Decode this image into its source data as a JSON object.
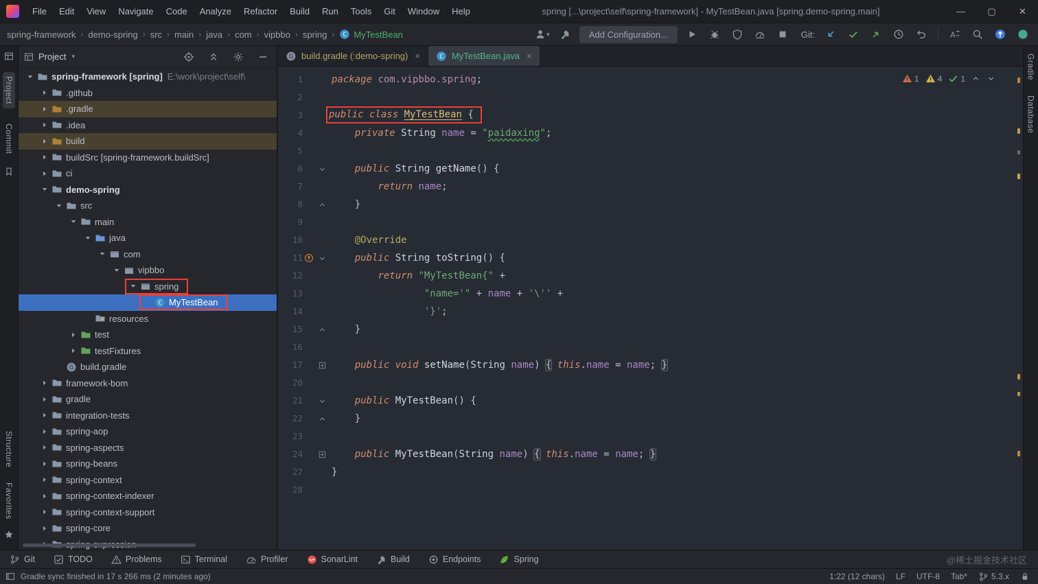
{
  "window": {
    "title": "spring [...\\project\\self\\spring-framework] - MyTestBean.java [spring.demo-spring.main]",
    "menus": [
      "File",
      "Edit",
      "View",
      "Navigate",
      "Code",
      "Analyze",
      "Refactor",
      "Build",
      "Run",
      "Tools",
      "Git",
      "Window",
      "Help"
    ],
    "controls": {
      "minimize": "—",
      "maximize": "▢",
      "close": "✕"
    }
  },
  "navbar": {
    "breadcrumbs": [
      "spring-framework",
      "demo-spring",
      "src",
      "main",
      "java",
      "com",
      "vipbbo",
      "spring"
    ],
    "breadcrumb_class": "MyTestBean",
    "actions": [
      {
        "icon": "user",
        "dropdown": true
      },
      {
        "icon": "hammer-green"
      },
      {
        "type": "button",
        "label": "Add Configuration..."
      },
      {
        "icon": "run"
      },
      {
        "icon": "debug"
      },
      {
        "icon": "coverage"
      },
      {
        "icon": "profiler-run"
      },
      {
        "icon": "stop"
      },
      {
        "type": "label",
        "label": "Git:"
      },
      {
        "icon": "update-project"
      },
      {
        "icon": "commit-check"
      },
      {
        "icon": "push"
      },
      {
        "icon": "history"
      },
      {
        "icon": "rollback"
      },
      {
        "type": "sep"
      },
      {
        "icon": "translate"
      },
      {
        "icon": "search"
      },
      {
        "icon": "updates"
      },
      {
        "icon": "status-dot"
      }
    ]
  },
  "left_stripe": {
    "top": [
      "Project",
      "Commit"
    ],
    "bottom": [
      "Structure",
      "Favorites"
    ]
  },
  "right_stripe": [
    "Gradle",
    "Database"
  ],
  "project": {
    "header": "Project",
    "header_actions": [
      "target",
      "collapse-all",
      "gear",
      "hide-minus"
    ],
    "tree": [
      {
        "d": 0,
        "chev": "open",
        "icon": "folder",
        "label": "spring-framework [spring]",
        "path": "E:\\work\\project\\self\\",
        "bold": true
      },
      {
        "d": 1,
        "chev": "closed",
        "icon": "folder",
        "label": ".github"
      },
      {
        "d": 1,
        "chev": "closed",
        "icon": "folder-excluded",
        "label": ".gradle",
        "hl": true
      },
      {
        "d": 1,
        "chev": "closed",
        "icon": "folder",
        "label": ".idea"
      },
      {
        "d": 1,
        "chev": "closed",
        "icon": "folder-excluded",
        "label": "build",
        "hl": true
      },
      {
        "d": 1,
        "chev": "closed",
        "icon": "folder",
        "label": "buildSrc [spring-framework.buildSrc]"
      },
      {
        "d": 1,
        "chev": "closed",
        "icon": "folder",
        "label": "ci"
      },
      {
        "d": 1,
        "chev": "open",
        "icon": "folder",
        "label": "demo-spring",
        "bold": true
      },
      {
        "d": 2,
        "chev": "open",
        "icon": "folder",
        "label": "src"
      },
      {
        "d": 3,
        "chev": "open",
        "icon": "folder",
        "label": "main"
      },
      {
        "d": 4,
        "chev": "open",
        "icon": "folder-source",
        "label": "java"
      },
      {
        "d": 5,
        "chev": "open",
        "icon": "package",
        "label": "com"
      },
      {
        "d": 6,
        "chev": "open",
        "icon": "package",
        "label": "vipbbo"
      },
      {
        "d": 7,
        "chev": "open",
        "icon": "package",
        "label": "spring",
        "redbox": true
      },
      {
        "d": 8,
        "chev": "none",
        "icon": "class",
        "label": "MyTestBean",
        "selected": true,
        "redbox": true
      },
      {
        "d": 4,
        "chev": "none",
        "icon": "folder-resources",
        "label": "resources"
      },
      {
        "d": 3,
        "chev": "closed",
        "icon": "folder-test",
        "label": "test"
      },
      {
        "d": 3,
        "chev": "closed",
        "icon": "folder-test",
        "label": "testFixtures"
      },
      {
        "d": 2,
        "chev": "none",
        "icon": "gradle",
        "label": "build.gradle"
      },
      {
        "d": 1,
        "chev": "closed",
        "icon": "folder",
        "label": "framework-bom"
      },
      {
        "d": 1,
        "chev": "closed",
        "icon": "folder",
        "label": "gradle"
      },
      {
        "d": 1,
        "chev": "closed",
        "icon": "folder",
        "label": "integration-tests"
      },
      {
        "d": 1,
        "chev": "closed",
        "icon": "folder",
        "label": "spring-aop"
      },
      {
        "d": 1,
        "chev": "closed",
        "icon": "folder",
        "label": "spring-aspects"
      },
      {
        "d": 1,
        "chev": "closed",
        "icon": "folder",
        "label": "spring-beans"
      },
      {
        "d": 1,
        "chev": "closed",
        "icon": "folder",
        "label": "spring-context"
      },
      {
        "d": 1,
        "chev": "closed",
        "icon": "folder",
        "label": "spring-context-indexer"
      },
      {
        "d": 1,
        "chev": "closed",
        "icon": "folder",
        "label": "spring-context-support"
      },
      {
        "d": 1,
        "chev": "closed",
        "icon": "folder",
        "label": "spring-core"
      },
      {
        "d": 1,
        "chev": "closed",
        "icon": "folder",
        "label": "spring-expression"
      }
    ]
  },
  "editor": {
    "tabs": [
      {
        "label": "build.gradle (:demo-spring)",
        "icon": "gradle",
        "active": false,
        "color": "#b6a763"
      },
      {
        "label": "MyTestBean.java",
        "icon": "class",
        "active": true,
        "color": "#52b787"
      }
    ],
    "inspections": {
      "items": [
        {
          "icon": "warn-red",
          "count": "1",
          "name": "weak-warnings-badge"
        },
        {
          "icon": "warn-yellow",
          "count": "4",
          "name": "warnings-badge"
        },
        {
          "icon": "ok-check",
          "count": "1",
          "name": "no-errors-badge"
        }
      ]
    },
    "code": [
      {
        "n": "1",
        "t": [
          [
            "kw",
            "package"
          ],
          [
            "pl",
            " "
          ],
          [
            "pkg",
            "com.vipbbo.spring"
          ],
          [
            "pl",
            ";"
          ]
        ]
      },
      {
        "n": "2",
        "t": []
      },
      {
        "n": "3",
        "box": true,
        "t": [
          [
            "kw",
            "public class"
          ],
          [
            "pl",
            " "
          ],
          [
            "cls",
            "MyTestBean"
          ],
          [
            "pl",
            " {"
          ]
        ]
      },
      {
        "n": "4",
        "t": [
          [
            "pl",
            "    "
          ],
          [
            "kw",
            "private"
          ],
          [
            "pl",
            " "
          ],
          [
            "typ",
            "String"
          ],
          [
            "pl",
            " "
          ],
          [
            "fld",
            "name"
          ],
          [
            "pl",
            " = "
          ],
          [
            "str",
            "\""
          ],
          [
            "typo",
            "paidaxing"
          ],
          [
            "str",
            "\""
          ],
          [
            "pl",
            ";"
          ]
        ]
      },
      {
        "n": "5",
        "t": []
      },
      {
        "n": "6",
        "f": "open",
        "t": [
          [
            "pl",
            "    "
          ],
          [
            "kw",
            "public"
          ],
          [
            "pl",
            " "
          ],
          [
            "typ",
            "String"
          ],
          [
            "pl",
            " "
          ],
          [
            "mtd",
            "getName"
          ],
          [
            "pl",
            "() {"
          ]
        ]
      },
      {
        "n": "7",
        "t": [
          [
            "pl",
            "        "
          ],
          [
            "kw",
            "return"
          ],
          [
            "pl",
            " "
          ],
          [
            "fld",
            "name"
          ],
          [
            "pl",
            ";"
          ]
        ]
      },
      {
        "n": "8",
        "f": "close",
        "t": [
          [
            "pl",
            "    }"
          ]
        ]
      },
      {
        "n": "9",
        "t": []
      },
      {
        "n": "10",
        "t": [
          [
            "pl",
            "    "
          ],
          [
            "ann",
            "@Override"
          ]
        ]
      },
      {
        "n": "11",
        "ic": "override",
        "f": "open",
        "t": [
          [
            "pl",
            "    "
          ],
          [
            "kw",
            "public"
          ],
          [
            "pl",
            " "
          ],
          [
            "typ",
            "String"
          ],
          [
            "pl",
            " "
          ],
          [
            "mtd",
            "toString"
          ],
          [
            "pl",
            "() {"
          ]
        ]
      },
      {
        "n": "12",
        "t": [
          [
            "pl",
            "        "
          ],
          [
            "kw",
            "return"
          ],
          [
            "pl",
            " "
          ],
          [
            "str",
            "\"MyTestBean{\""
          ],
          [
            "pl",
            " +"
          ]
        ]
      },
      {
        "n": "13",
        "t": [
          [
            "pl",
            "                "
          ],
          [
            "str",
            "\"name='\""
          ],
          [
            "pl",
            " + "
          ],
          [
            "fld",
            "name"
          ],
          [
            "pl",
            " + "
          ],
          [
            "str",
            "'\\''"
          ],
          [
            "pl",
            " +"
          ]
        ]
      },
      {
        "n": "14",
        "t": [
          [
            "pl",
            "                "
          ],
          [
            "str",
            "'}'"
          ],
          [
            "pl",
            ";"
          ]
        ]
      },
      {
        "n": "15",
        "f": "close",
        "t": [
          [
            "pl",
            "    }"
          ]
        ]
      },
      {
        "n": "16",
        "t": []
      },
      {
        "n": "17",
        "f": "plus",
        "t": [
          [
            "pl",
            "    "
          ],
          [
            "kw",
            "public void"
          ],
          [
            "pl",
            " "
          ],
          [
            "mtd",
            "setName"
          ],
          [
            "pl",
            "("
          ],
          [
            "typ",
            "String"
          ],
          [
            "pl",
            " "
          ],
          [
            "fld",
            "name"
          ],
          [
            "pl",
            ") "
          ],
          [
            "fb",
            "{"
          ],
          [
            "pl",
            " "
          ],
          [
            "kw",
            "this"
          ],
          [
            "pl",
            "."
          ],
          [
            "fld",
            "name"
          ],
          [
            "pl",
            " = "
          ],
          [
            "fld",
            "name"
          ],
          [
            "pl",
            "; "
          ],
          [
            "fb",
            "}"
          ]
        ]
      },
      {
        "n": "20",
        "t": []
      },
      {
        "n": "21",
        "f": "open",
        "t": [
          [
            "pl",
            "    "
          ],
          [
            "kw",
            "public"
          ],
          [
            "pl",
            " "
          ],
          [
            "mtd",
            "MyTestBean"
          ],
          [
            "pl",
            "() {"
          ]
        ]
      },
      {
        "n": "22",
        "f": "close",
        "t": [
          [
            "pl",
            "    }"
          ]
        ]
      },
      {
        "n": "23",
        "t": []
      },
      {
        "n": "24",
        "f": "plus",
        "t": [
          [
            "pl",
            "    "
          ],
          [
            "kw",
            "public"
          ],
          [
            "pl",
            " "
          ],
          [
            "mtd",
            "MyTestBean"
          ],
          [
            "pl",
            "("
          ],
          [
            "typ",
            "String"
          ],
          [
            "pl",
            " "
          ],
          [
            "fld",
            "name"
          ],
          [
            "pl",
            ") "
          ],
          [
            "fb",
            "{"
          ],
          [
            "pl",
            " "
          ],
          [
            "kw",
            "this"
          ],
          [
            "pl",
            "."
          ],
          [
            "fld",
            "name"
          ],
          [
            "pl",
            " = "
          ],
          [
            "fld",
            "name"
          ],
          [
            "pl",
            "; "
          ],
          [
            "fb",
            "}"
          ]
        ]
      },
      {
        "n": "27",
        "t": [
          [
            "pl",
            "}"
          ]
        ]
      },
      {
        "n": "28",
        "t": []
      }
    ]
  },
  "bottom_bar": [
    {
      "label": "Git",
      "icon": "git-branch"
    },
    {
      "label": "TODO",
      "icon": "todo"
    },
    {
      "label": "Problems",
      "icon": "problems"
    },
    {
      "label": "Terminal",
      "icon": "terminal"
    },
    {
      "label": "Profiler",
      "icon": "profiler"
    },
    {
      "label": "SonarLint",
      "icon": "sonarlint"
    },
    {
      "label": "Build",
      "icon": "build-hammer"
    },
    {
      "label": "Endpoints",
      "icon": "endpoints"
    },
    {
      "label": "Spring",
      "icon": "spring-leaf"
    }
  ],
  "status_bar": {
    "message": "Gradle sync finished in 17 s 266 ms (2 minutes ago)",
    "items": [
      {
        "name": "caret-position",
        "text": "1:22 (12 chars)"
      },
      {
        "name": "line-separator",
        "text": "LF"
      },
      {
        "name": "file-encoding",
        "text": "UTF-8"
      },
      {
        "name": "indent-style",
        "text": "Tab*"
      },
      {
        "name": "git-branch",
        "icon": "branch",
        "text": "5.3.x"
      },
      {
        "name": "read-lock",
        "icon": "lock"
      }
    ]
  },
  "watermark": "@稀土掘金技术社区",
  "icons": {
    "class": "blue-circle-C",
    "gradle": "gray-circle-G",
    "folder": "gray-folder",
    "folder-source": "blue-folder",
    "folder-test": "green-folder",
    "folder-excluded": "orange-folder",
    "folder-resources": "gray-folder-dot",
    "package": "gray-box",
    "search": "magnifier",
    "user": "person-silhouette",
    "commit-check": "green-check",
    "push": "green-up-right-arrow",
    "update-project": "blue-down-left-arrow",
    "sonarlint": "red-circle-wave",
    "spring-leaf": "green-leaf",
    "warn-red": "orange-warning-triangle",
    "warn-yellow": "yellow-warning-triangle",
    "ok-check": "green-check",
    "lock": "padlock",
    "branch": "git-branch",
    "override": "orange-up-arrow-circle"
  },
  "colors": {
    "selection_blue": "#3d6fc1",
    "excluded_row": "#494130",
    "annotation_red": "#ec3f38",
    "editor_bg": "#272b34",
    "panel_bg": "#26272c",
    "keyword": "#cf8e6d",
    "string": "#69aa6e",
    "field": "#ab87c9"
  }
}
